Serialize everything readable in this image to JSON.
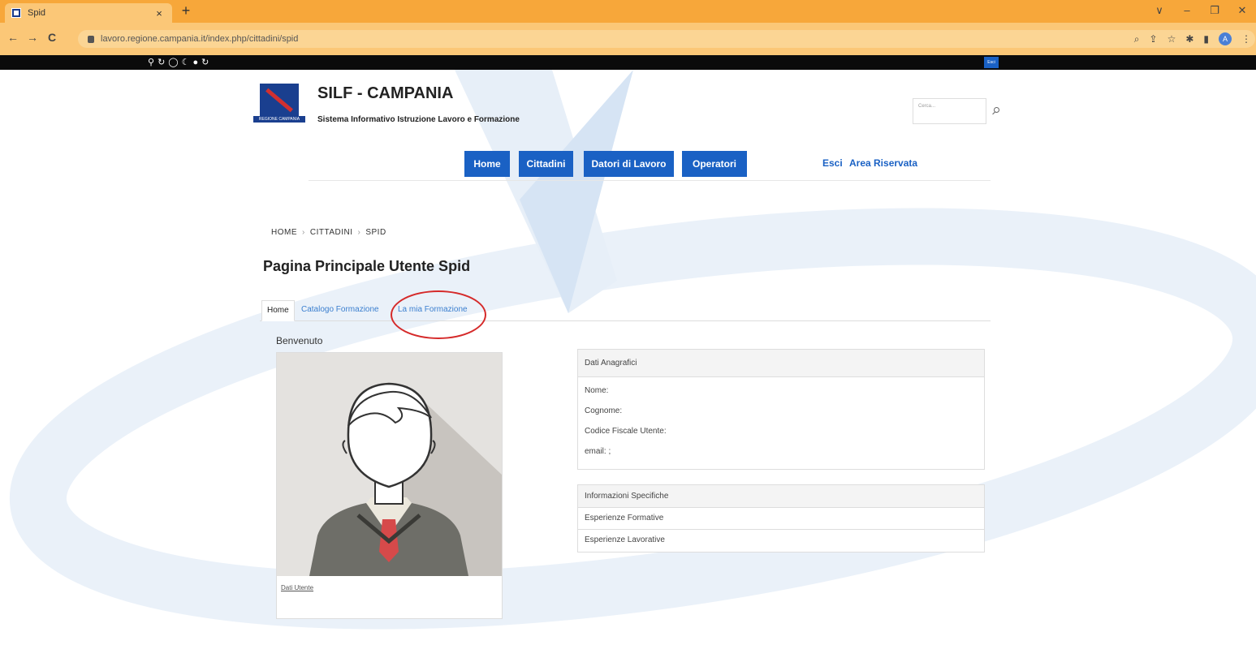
{
  "browser": {
    "tab_title": "Spid",
    "tab_close": "×",
    "new_tab": "+",
    "url": "lavoro.regione.campania.it/index.php/cittadini/spid",
    "back": "←",
    "forward": "→",
    "reload": "C",
    "win_minimize_chev": "∨",
    "win_minimize": "–",
    "win_restore": "❐",
    "win_close": "✕",
    "profile_initial": "A",
    "toolbar_icons": [
      "⌕",
      "⇪",
      "☆",
      "✱",
      "▮",
      "⋮"
    ],
    "accent": "#f7a73a"
  },
  "accessibility_bar": {
    "icons": [
      "⚲",
      "↻",
      "◯",
      "☾",
      "●",
      "↻"
    ],
    "exit_label": "Esci"
  },
  "header": {
    "logo_text": "REGIONE CAMPANIA",
    "title": "SILF - CAMPANIA",
    "subtitle": "Sistema Informativo Istruzione Lavoro e Formazione",
    "search_placeholder": "Cerca..."
  },
  "nav": {
    "items": [
      "Home",
      "Cittadini",
      "Datori di Lavoro",
      "Operatori"
    ],
    "links": [
      "Esci",
      "Area Riservata"
    ],
    "color": "#1a61c4"
  },
  "breadcrumb": {
    "items": [
      "HOME",
      "CITTADINI",
      "SPID"
    ],
    "separator": "›"
  },
  "page": {
    "title": "Pagina Principale Utente Spid",
    "tabs": [
      "Home",
      "Catalogo Formazione",
      "La mia Formazione"
    ],
    "welcome": "Benvenuto"
  },
  "user_card": {
    "link": "Dati Utente"
  },
  "personal_data": {
    "title": "Dati Anagrafici",
    "fields": [
      "Nome:",
      "Cognome:",
      "Codice Fiscale Utente:",
      "email: ;"
    ]
  },
  "specific_info": {
    "title": "Informazioni Specifiche",
    "rows": [
      "Esperienze Formative",
      "Esperienze Lavorative"
    ]
  }
}
